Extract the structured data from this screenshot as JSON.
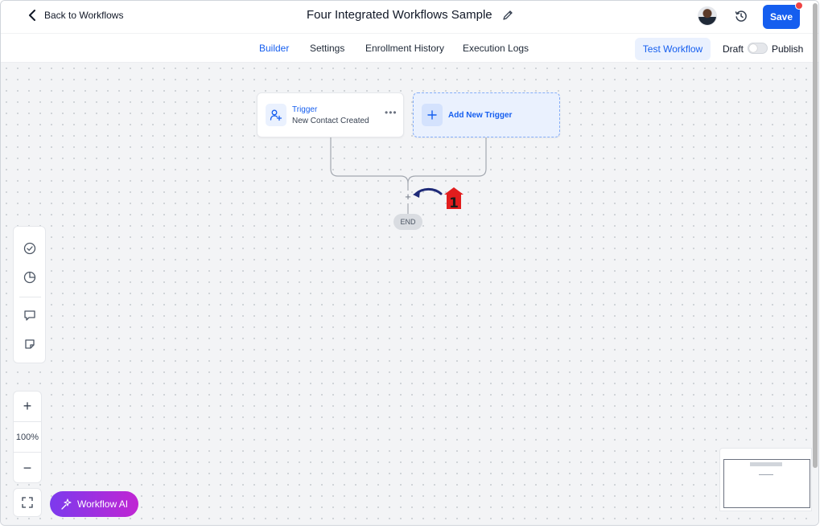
{
  "header": {
    "back_label": "Back to Workflows",
    "title": "Four Integrated Workflows Sample",
    "save_label": "Save",
    "icons": {
      "back": "chevron-left-icon",
      "edit": "pencil-icon",
      "history": "clock-history-icon"
    }
  },
  "tabs": [
    {
      "label": "Builder",
      "active": true
    },
    {
      "label": "Settings",
      "active": false
    },
    {
      "label": "Enrollment History",
      "active": false
    },
    {
      "label": "Execution Logs",
      "active": false
    }
  ],
  "actions": {
    "test_label": "Test Workflow",
    "draft_label": "Draft",
    "publish_label": "Publish",
    "published": false
  },
  "canvas": {
    "trigger": {
      "title": "Trigger",
      "subtitle": "New Contact Created",
      "more": "•••"
    },
    "add_trigger_label": "Add New Trigger",
    "add_action_symbol": "+",
    "end_label": "END",
    "annotation_number": "1"
  },
  "controls": {
    "zoom_in": "+",
    "zoom_level": "100%",
    "zoom_out": "−",
    "ai_label": "Workflow AI"
  },
  "colors": {
    "accent": "#155eef",
    "accent_light": "#eaf1fe",
    "ai_gradient_start": "#7c3aed",
    "ai_gradient_end": "#c026d3",
    "annotation_red": "#e11d1d",
    "annotation_arrow": "#1e2a78"
  }
}
